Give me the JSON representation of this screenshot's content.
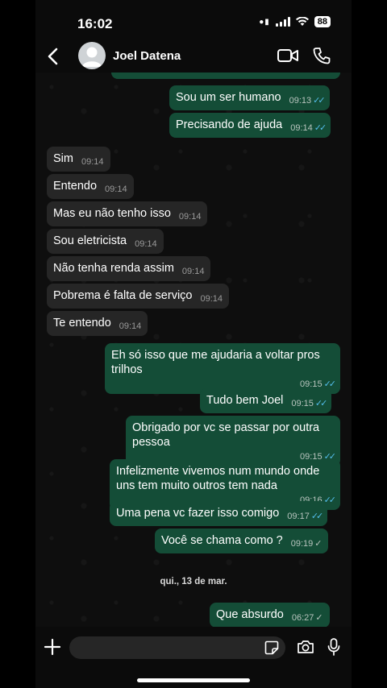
{
  "status_bar": {
    "time": "16:02",
    "battery": "88"
  },
  "header": {
    "contact_name": "Joel Datena"
  },
  "messages": [
    {
      "dir": "out",
      "text": "Sou um ser humano",
      "time": "09:13",
      "tick": "read"
    },
    {
      "dir": "out",
      "text": "Precisando de ajuda",
      "time": "09:14",
      "tick": "read"
    },
    {
      "dir": "in",
      "text": "Sim",
      "time": "09:14"
    },
    {
      "dir": "in",
      "text": "Entendo",
      "time": "09:14"
    },
    {
      "dir": "in",
      "text": "Mas eu não tenho isso",
      "time": "09:14"
    },
    {
      "dir": "in",
      "text": "Sou eletricista",
      "time": "09:14"
    },
    {
      "dir": "in",
      "text": "Não tenha renda assim",
      "time": "09:14"
    },
    {
      "dir": "in",
      "text": "Pobrema é falta de serviço",
      "time": "09:14"
    },
    {
      "dir": "in",
      "text": "Te entendo",
      "time": "09:14"
    },
    {
      "dir": "out",
      "text": "Eh só isso que me ajudaria a voltar  pros trilhos",
      "time": "09:15",
      "tick": "read"
    },
    {
      "dir": "out",
      "text": "Tudo bem Joel",
      "time": "09:15",
      "tick": "read"
    },
    {
      "dir": "out",
      "text": "Obrigado por vc se passar por outra pessoa",
      "time": "09:15",
      "tick": "read"
    },
    {
      "dir": "out",
      "text": "Infelizmente vivemos num mundo onde uns tem muito outros tem nada",
      "time": "09:16",
      "tick": "read"
    },
    {
      "dir": "out",
      "text": "Uma pena vc fazer isso comigo",
      "time": "09:17",
      "tick": "read"
    },
    {
      "dir": "out",
      "text": "Você se chama como ?",
      "time": "09:19",
      "tick": "delivered"
    },
    {
      "dir": "out",
      "text": "Que absurdo",
      "time": "06:27",
      "tick": "delivered"
    }
  ],
  "date_separator": "qui., 13 de mar.",
  "colors": {
    "outgoing_bubble": "#144d37",
    "incoming_bubble": "#262626",
    "read_tick": "#53bdeb"
  },
  "icons": [
    "back-icon",
    "avatar",
    "video-call-icon",
    "phone-call-icon",
    "plus-icon",
    "sticker-icon",
    "camera-icon",
    "mic-icon"
  ]
}
